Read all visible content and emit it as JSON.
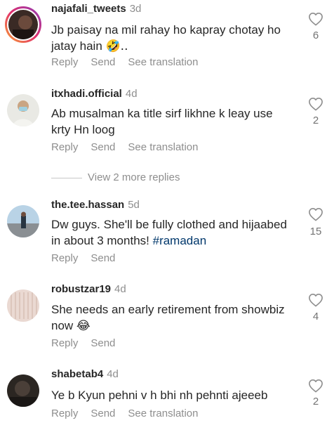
{
  "comments": [
    {
      "username": "najafali_tweets",
      "time": "3d",
      "text": "Jb paisay na mil rahay ho kapray chotay ho jatay hain",
      "emoji": "🤣..",
      "likes": "6",
      "actions": {
        "reply": "Reply",
        "send": "Send",
        "translate": "See translation"
      }
    },
    {
      "username": "itxhadi.official",
      "time": "4d",
      "text": "Ab musalman ka title sirf likhne k leay use krty Hn loog",
      "likes": "2",
      "actions": {
        "reply": "Reply",
        "send": "Send",
        "translate": "See translation"
      }
    },
    {
      "username": "the.tee.hassan",
      "time": "5d",
      "text": "Dw guys. She'll be fully clothed and hijaabed in about 3 months!",
      "hashtag": "#ramadan",
      "likes": "15",
      "actions": {
        "reply": "Reply",
        "send": "Send"
      }
    },
    {
      "username": "robustzar19",
      "time": "4d",
      "text": "She needs an early retirement from showbiz now",
      "emoji": "😂",
      "likes": "4",
      "actions": {
        "reply": "Reply",
        "send": "Send"
      }
    },
    {
      "username": "shabetab4",
      "time": "4d",
      "text": "Ye b Kyun pehni v h bhi nh pehnti ajeeeb",
      "likes": "2",
      "actions": {
        "reply": "Reply",
        "send": "Send",
        "translate": "See translation"
      }
    }
  ],
  "view_replies_label": "View 2 more replies",
  "icons": {
    "like": "heart-outline-icon"
  },
  "colors": {
    "text": "#262626",
    "secondary": "#8e8e8e",
    "hashtag": "#00376b"
  }
}
